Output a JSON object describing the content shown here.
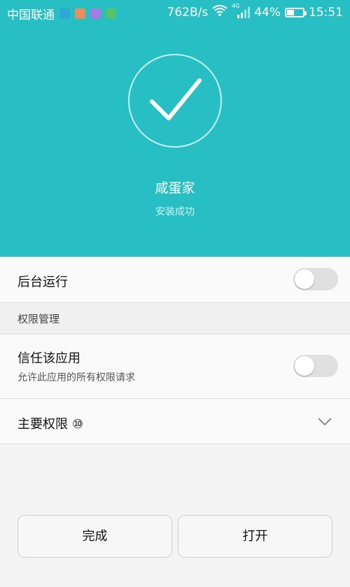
{
  "status_bar": {
    "carrier": "中国联通",
    "speed": "762B/s",
    "network_type": "4G",
    "battery": "44%",
    "battery_level": 0.44,
    "time": "15:51",
    "notification_icons": [
      "app-notification-icon",
      "shopping-icon",
      "gallery-icon",
      "wechat-icon"
    ],
    "icons": [
      "wifi-icon",
      "signal-icon",
      "battery-charging-icon"
    ]
  },
  "install": {
    "app_name": "咸蛋家",
    "status": "安装成功",
    "icon": "check-icon",
    "header_color": "#27bfc3"
  },
  "settings": {
    "background_run": {
      "label": "后台运行",
      "enabled": false
    },
    "permission_section": {
      "label": "权限管理"
    },
    "trust_app": {
      "label": "信任该应用",
      "description": "允许此应用的所有权限请求",
      "enabled": false
    },
    "main_permissions": {
      "label": "主要权限",
      "count": "⑩",
      "icon": "chevron-down-icon"
    }
  },
  "buttons": {
    "done": "完成",
    "open": "打开"
  }
}
